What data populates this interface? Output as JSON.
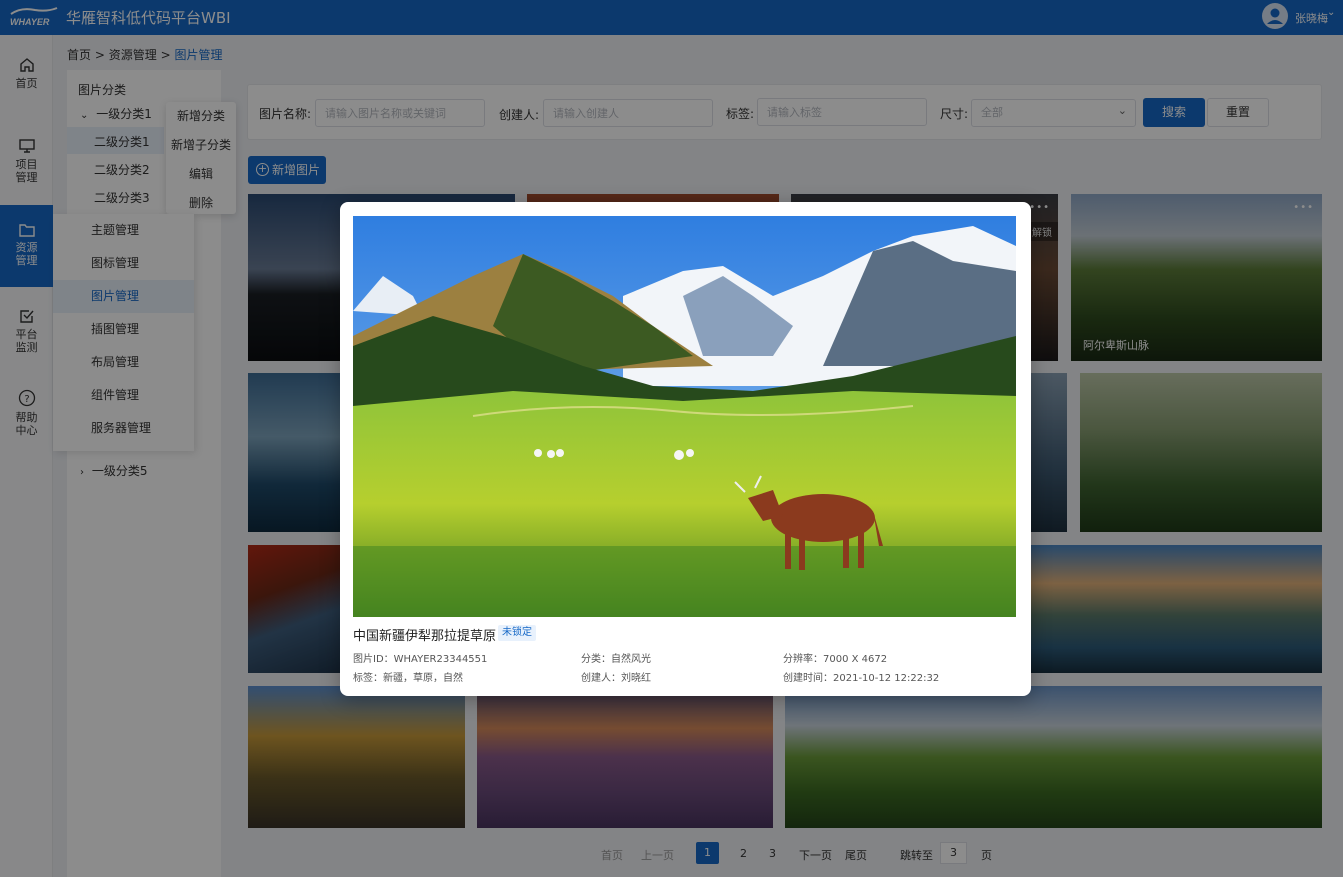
{
  "app": {
    "brand": "WHAYER",
    "title": "华雁智科低代码平台WBI",
    "user_name": "张晓梅"
  },
  "nav": [
    {
      "label1": "首页",
      "label2": "",
      "icon": "home-icon"
    },
    {
      "label1": "项目",
      "label2": "管理",
      "icon": "monitor-icon"
    },
    {
      "label1": "资源",
      "label2": "管理",
      "icon": "folder-icon"
    },
    {
      "label1": "平台",
      "label2": "监测",
      "icon": "checkbox-icon"
    },
    {
      "label1": "帮助",
      "label2": "中心",
      "icon": "help-icon"
    }
  ],
  "breadcrumb": {
    "home": "首页",
    "sep": ">",
    "parent": "资源管理",
    "current": "图片管理"
  },
  "tree": {
    "title": "图片分类",
    "level1_first": "一级分类1",
    "children": [
      "二级分类1",
      "二级分类2",
      "二级分类3"
    ],
    "level1_last": "一级分类5"
  },
  "context_menu": [
    "新增分类",
    "新增子分类",
    "编辑",
    "删除"
  ],
  "resource_menu": [
    "主题管理",
    "图标管理",
    "图片管理",
    "插图管理",
    "布局管理",
    "组件管理",
    "服务器管理"
  ],
  "filter": {
    "name_label": "图片名称:",
    "name_placeholder": "请输入图片名称或关键词",
    "creator_label": "创建人:",
    "creator_placeholder": "请输入创建人",
    "tag_label": "标签:",
    "tag_placeholder": "请输入标签",
    "size_label": "尺寸:",
    "size_value": "全部",
    "search": "搜索",
    "reset": "重置"
  },
  "add_button": "新增图片",
  "thumbs": {
    "caption_alps": "阿尔卑斯山脉",
    "unlock": "解锁"
  },
  "pagination": {
    "first": "首页",
    "prev": "上一页",
    "pages": [
      "1",
      "2",
      "3"
    ],
    "next": "下一页",
    "last": "尾页",
    "jump_label": "跳转至",
    "jump_value": "3",
    "jump_unit": "页"
  },
  "modal": {
    "title": "中国新疆伊犁那拉提草原",
    "badge": "未锁定",
    "id": "图片ID：WHAYER23344551",
    "category": "分类：自然风光",
    "resolution": "分辨率：7000 X 4672",
    "tags": "标签：新疆，草原，自然",
    "creator": "创建人：刘晓红",
    "created": "创建时间：2021-10-12 12:22:32"
  },
  "colors": {
    "primary": "#1769c7"
  }
}
